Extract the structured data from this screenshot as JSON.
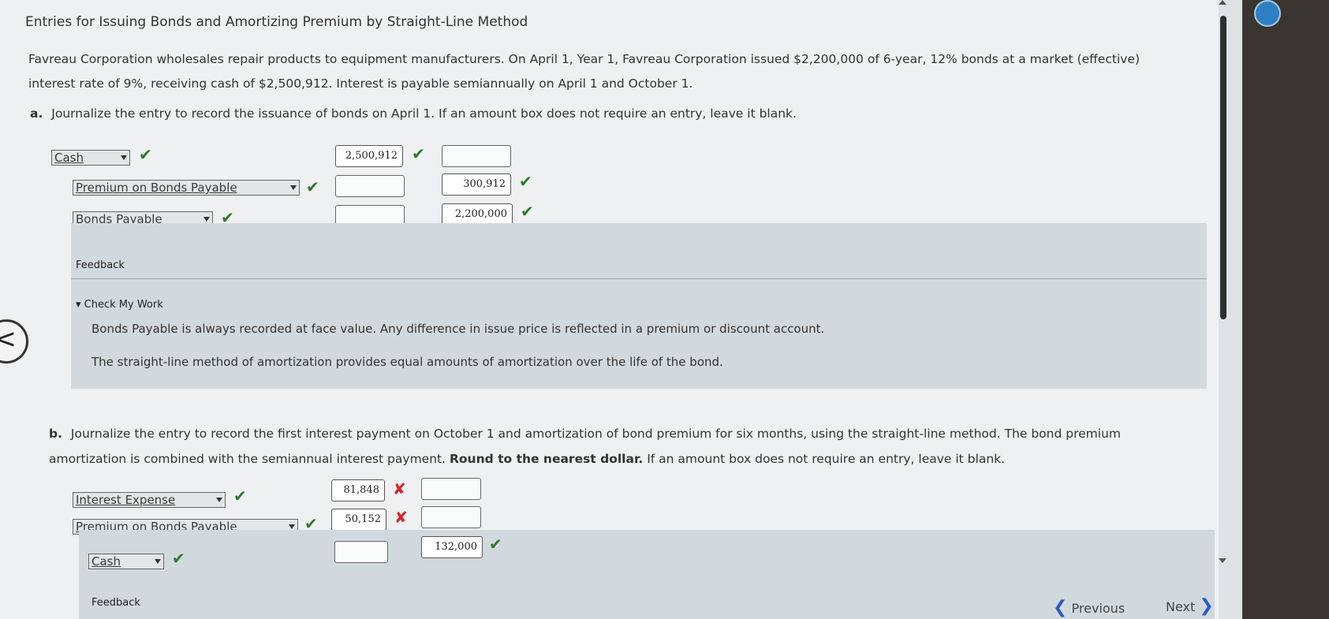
{
  "title": "Entries for Issuing Bonds and Amortizing Premium by Straight-Line Method",
  "intro": {
    "line1": "Favreau Corporation wholesales repair products to equipment manufacturers. On April 1, Year 1, Favreau Corporation issued $2,200,000 of 6-year, 12% bonds at a market (effective)",
    "line2": "interest rate of 9%, receiving cash of $2,500,912. Interest is payable semiannually on April 1 and October 1."
  },
  "part_a": {
    "letter": "a.",
    "text": "Journalize the entry to record the issuance of bonds on April 1. If an amount box does not require an entry, leave it blank.",
    "rows": [
      {
        "account": "Cash",
        "debit": "2,500,912",
        "credit": ""
      },
      {
        "account": "Premium on Bonds Payable",
        "debit": "",
        "credit": "300,912"
      },
      {
        "account": "Bonds Payable",
        "debit": "",
        "credit": "2,200,000"
      }
    ]
  },
  "feedback": {
    "title": "Feedback",
    "toggle": "Check My Work",
    "line1": "Bonds Payable is always recorded at face value. Any difference in issue price is reflected in a premium or discount account.",
    "line2": "The straight-line method of amortization provides equal amounts of amortization over the life of the bond."
  },
  "part_b": {
    "letter": "b.",
    "text1": "Journalize the entry to record the first interest payment on October 1 and amortization of bond premium for six months, using the straight-line method. The bond premium",
    "text2_pre": "amortization is combined with the semiannual interest payment.",
    "text2_bold": "Round to the nearest dollar.",
    "text2_post": "If an amount box does not require an entry, leave it blank.",
    "rows": [
      {
        "account": "Interest Expense",
        "debit": "81,848",
        "credit": ""
      },
      {
        "account": "Premium on Bonds Payable",
        "debit": "50,152",
        "credit": ""
      },
      {
        "account": "Cash",
        "debit": "",
        "credit": "132,000"
      }
    ]
  },
  "feedback2": {
    "title": "Feedback"
  },
  "nav": {
    "previous": "Previous",
    "next": "Next"
  },
  "marks": {
    "check": "✔",
    "x": "✘"
  },
  "colors": {
    "correct": "#2b7a2b",
    "incorrect": "#d8232a",
    "panel": "#d2d9de"
  }
}
